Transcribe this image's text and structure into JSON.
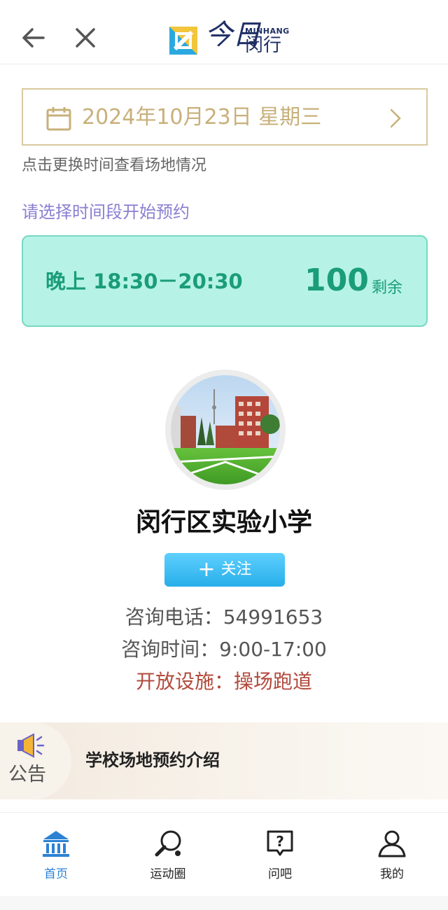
{
  "header": {
    "logo_cn": "闵行",
    "logo_en": "MINHANG",
    "logo_mark": "今日"
  },
  "date_picker": {
    "date_text": "2024年10月23日 星期三",
    "hint": "点击更换时间查看场地情况"
  },
  "booking": {
    "prompt": "请选择时间段开始预约",
    "slot": {
      "time_label": "晚上 18:30－20:30",
      "remaining": "100",
      "remaining_unit": "剩余"
    }
  },
  "venue": {
    "name": "闵行区实验小学",
    "follow_label": "关注",
    "phone": "咨询电话：54991653",
    "hours": "咨询时间：9:00-17:00",
    "facilities": "开放设施：操场跑道"
  },
  "notice": {
    "label": "公告",
    "title": "学校场地预约介绍"
  },
  "bottom_nav": {
    "items": [
      {
        "label": "首页",
        "icon": "home-bank-icon",
        "active": true
      },
      {
        "label": "运动圈",
        "icon": "ping-pong-icon",
        "active": false
      },
      {
        "label": "问吧",
        "icon": "question-bubble-icon",
        "active": false
      },
      {
        "label": "我的",
        "icon": "user-icon",
        "active": false
      }
    ]
  },
  "colors": {
    "accent_gold": "#c8b07a",
    "slot_green": "#1a9d78",
    "slot_bg": "#b6f3e6",
    "follow_blue": "#27aee9",
    "nav_active": "#2b82d4",
    "facility_red": "#b24a3c"
  }
}
